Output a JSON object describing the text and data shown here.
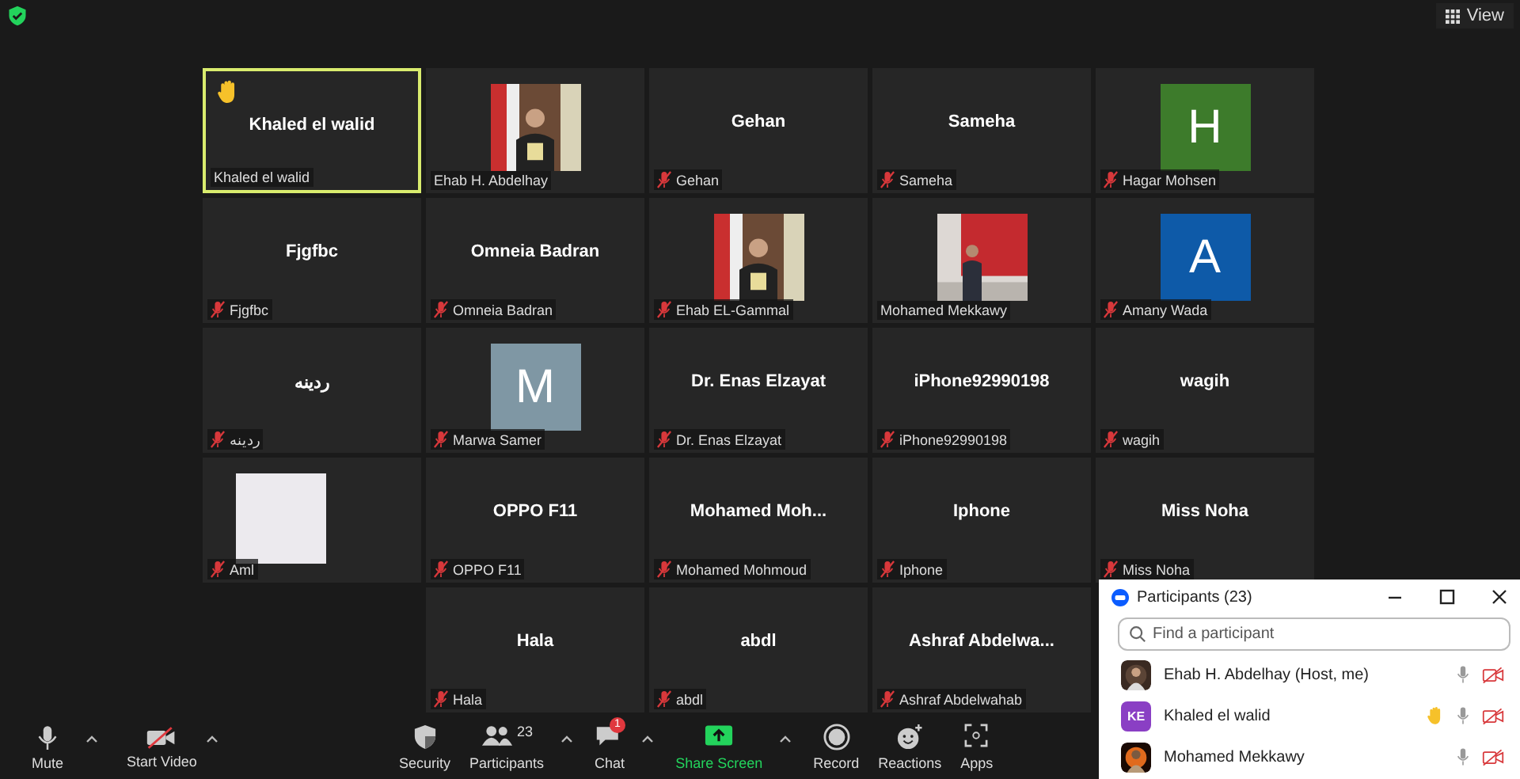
{
  "top_bar": {
    "view_label": "View"
  },
  "tiles": [
    {
      "kind": "name",
      "display": "Khaled el walid",
      "label": "Khaled el walid",
      "muted": false,
      "active_speaker": true,
      "hand_raised": true
    },
    {
      "kind": "picture",
      "label": "Ehab H. Abdelhay",
      "muted": false,
      "active_speaker": false,
      "hand_raised": false
    },
    {
      "kind": "name",
      "display": "Gehan",
      "label": "Gehan",
      "muted": true,
      "active_speaker": false,
      "hand_raised": false
    },
    {
      "kind": "name",
      "display": "Sameha",
      "label": "Sameha",
      "muted": true,
      "active_speaker": false,
      "hand_raised": false
    },
    {
      "kind": "avatar",
      "letter": "H",
      "color": "#3d7b2b",
      "label": "Hagar Mohsen",
      "muted": true,
      "active_speaker": false,
      "hand_raised": false
    },
    {
      "kind": "name",
      "display": "Fjgfbc",
      "label": "Fjgfbc",
      "muted": true,
      "active_speaker": false,
      "hand_raised": false
    },
    {
      "kind": "name",
      "display": "Omneia Badran",
      "label": "Omneia Badran",
      "muted": true,
      "active_speaker": false,
      "hand_raised": false
    },
    {
      "kind": "picture",
      "label": "Ehab EL-Gammal",
      "muted": true,
      "active_speaker": false,
      "hand_raised": false
    },
    {
      "kind": "picture",
      "label": "Mohamed Mekkawy",
      "muted": false,
      "active_speaker": false,
      "hand_raised": false
    },
    {
      "kind": "avatar",
      "letter": "A",
      "color": "#0e5aa8",
      "label": "Amany Wada",
      "muted": true,
      "active_speaker": false,
      "hand_raised": false
    },
    {
      "kind": "name",
      "display": "ردينه",
      "label": "ردينه",
      "muted": true,
      "active_speaker": false,
      "hand_raised": false
    },
    {
      "kind": "avatar",
      "letter": "M",
      "color": "#7f97a4",
      "label": "Marwa Samer",
      "muted": true,
      "active_speaker": false,
      "hand_raised": false
    },
    {
      "kind": "name",
      "display": "Dr. Enas Elzayat",
      "label": "Dr. Enas Elzayat",
      "muted": true,
      "active_speaker": false,
      "hand_raised": false
    },
    {
      "kind": "name",
      "display": "iPhone92990198",
      "label": "iPhone92990198",
      "muted": true,
      "active_speaker": false,
      "hand_raised": false
    },
    {
      "kind": "name",
      "display": "wagih",
      "label": "wagih",
      "muted": true,
      "active_speaker": false,
      "hand_raised": false
    },
    {
      "kind": "blank",
      "label": "Aml",
      "muted": true,
      "active_speaker": false,
      "hand_raised": false
    },
    {
      "kind": "name",
      "display": "OPPO F11",
      "label": "OPPO F11",
      "muted": true,
      "active_speaker": false,
      "hand_raised": false
    },
    {
      "kind": "name",
      "display": "Mohamed  Moh...",
      "label": "Mohamed Mohmoud",
      "muted": true,
      "active_speaker": false,
      "hand_raised": false
    },
    {
      "kind": "name",
      "display": "Iphone",
      "label": "Iphone",
      "muted": true,
      "active_speaker": false,
      "hand_raised": false
    },
    {
      "kind": "name",
      "display": "Miss Noha",
      "label": "Miss Noha",
      "muted": true,
      "active_speaker": false,
      "hand_raised": false
    },
    {
      "kind": "name",
      "display": "Hala",
      "label": "Hala",
      "muted": true,
      "active_speaker": false,
      "hand_raised": false
    },
    {
      "kind": "name",
      "display": "abdl",
      "label": "abdl",
      "muted": true,
      "active_speaker": false,
      "hand_raised": false
    },
    {
      "kind": "name",
      "display": "Ashraf  Abdelwa...",
      "label": "Ashraf Abdelwahab",
      "muted": true,
      "active_speaker": false,
      "hand_raised": false
    }
  ],
  "toolbar": {
    "left": [
      {
        "kind": "mic",
        "label": "Mute",
        "caret": true
      },
      {
        "kind": "video-off",
        "label": "Start Video",
        "caret": true
      }
    ],
    "center": [
      {
        "kind": "security",
        "label": "Security",
        "caret": false
      },
      {
        "kind": "participants",
        "label": "Participants",
        "count": "23",
        "caret": true
      },
      {
        "kind": "chat",
        "label": "Chat",
        "badge": "1",
        "caret": true
      },
      {
        "kind": "share",
        "label": "Share Screen",
        "caret": true
      },
      {
        "kind": "record",
        "label": "Record",
        "caret": false
      },
      {
        "kind": "reactions",
        "label": "Reactions",
        "caret": false
      },
      {
        "kind": "apps",
        "label": "Apps",
        "caret": false
      }
    ]
  },
  "participants_panel": {
    "title": "Participants (23)",
    "search": {
      "placeholder": "Find a participant"
    },
    "rows": [
      {
        "kind": "picture",
        "name": "Ehab H. Abdelhay (Host, me)",
        "hand_raised": false,
        "muted": false,
        "video_off": true
      },
      {
        "kind": "initials",
        "initials": "KE",
        "color": "#8a3fc4",
        "name": "Khaled el walid",
        "hand_raised": true,
        "muted": false,
        "video_off": true
      },
      {
        "kind": "picture",
        "name": "Mohamed Mekkawy",
        "hand_raised": false,
        "muted": false,
        "video_off": true
      }
    ]
  }
}
